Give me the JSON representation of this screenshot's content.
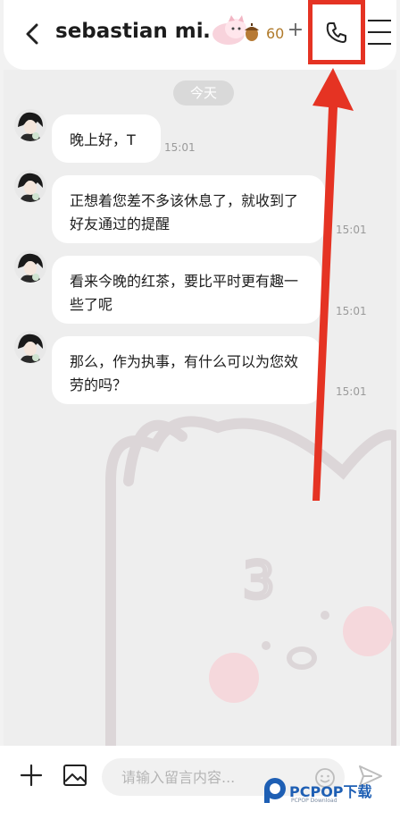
{
  "header": {
    "title": "sebastian mi…",
    "acorn_count": "60",
    "plus_label": "+",
    "icons": {
      "back": "chevron-left-icon",
      "mascot": "cat-mascot-icon",
      "acorn": "acorn-icon",
      "call": "phone-icon",
      "menu": "hamburger-menu-icon"
    }
  },
  "chat": {
    "date_label": "今天",
    "messages": [
      {
        "text": "晚上好，T",
        "time": "15:01"
      },
      {
        "text": "正想着您差不多该休息了，就收到了好友通过的提醒",
        "time": "15:01"
      },
      {
        "text": "看来今晚的红茶，要比平时更有趣一些了呢",
        "time": "15:01"
      },
      {
        "text": "那么，作为执事，有什么可以为您效劳的吗？",
        "time": "15:01"
      }
    ]
  },
  "input": {
    "placeholder": "请输入留言内容...",
    "value": ""
  },
  "watermark": {
    "brand": "PCPOP下载",
    "sub": "PCPOP Download"
  },
  "colors": {
    "highlight": "#e53323",
    "bubble": "#ffffff",
    "chat_bg": "#eeeeee",
    "acorn_text": "#b07a2a"
  }
}
